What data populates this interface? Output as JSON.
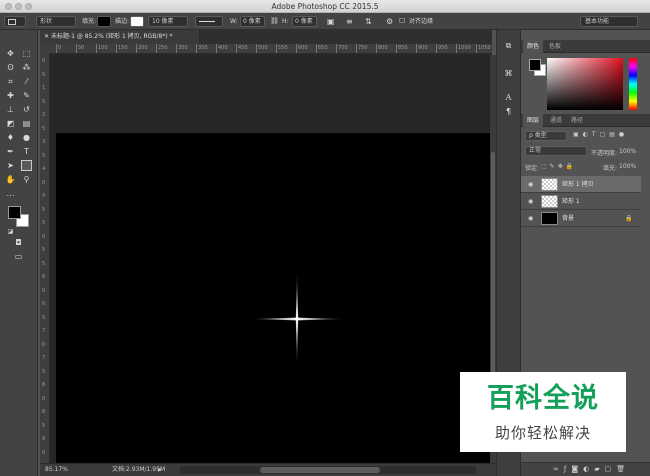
{
  "window": {
    "title": "Adobe Photoshop CC 2015.5"
  },
  "options_bar": {
    "mode_value": "形状",
    "fill_label": "填充:",
    "stroke_label": "描边:",
    "stroke_width": "10 像素",
    "w_label": "W:",
    "w_value": "0 像素",
    "h_label": "H:",
    "h_value": "0 像素",
    "align_edges_label": "对齐边缘",
    "workspace": "基本功能"
  },
  "document": {
    "tab_title": "未标题-1 @ 85.2% (矩形 1 拷贝, RGB/8*) *",
    "zoom": "85.17%",
    "doc_size": "文档:2.93M/1.95M"
  },
  "rulers": {
    "h_ticks": [
      "0",
      "50",
      "100",
      "150",
      "200",
      "250",
      "300",
      "350",
      "400",
      "450",
      "500",
      "550",
      "600",
      "650",
      "700",
      "750",
      "800",
      "850",
      "900",
      "950",
      "1000",
      "1050"
    ],
    "v_ticks": [
      "0",
      "5",
      "1",
      "5",
      "2",
      "5",
      "3",
      "5",
      "4",
      "0",
      "4",
      "5",
      "5",
      "0",
      "5",
      "5",
      "6",
      "0",
      "6",
      "5",
      "7",
      "0",
      "7",
      "5",
      "8",
      "0",
      "8",
      "5",
      "9",
      "0"
    ]
  },
  "color_panel": {
    "tabs": [
      "颜色",
      "色板"
    ]
  },
  "layers_panel": {
    "tabs": [
      "图层",
      "通道",
      "路径"
    ],
    "filter_kind": "ρ 类型",
    "blend_mode": "正常",
    "opacity_label": "不透明度:",
    "opacity_value": "100%",
    "lock_label": "锁定:",
    "fill_label": "填充:",
    "fill_value": "100%",
    "layers": [
      {
        "name": "矩形 1 拷贝",
        "selected": true
      },
      {
        "name": "矩形 1",
        "selected": false
      },
      {
        "name": "背景",
        "selected": false
      }
    ]
  },
  "watermark": {
    "main": "百科全说",
    "sub": "助你轻松解决",
    "main_color": "#12a05a"
  }
}
